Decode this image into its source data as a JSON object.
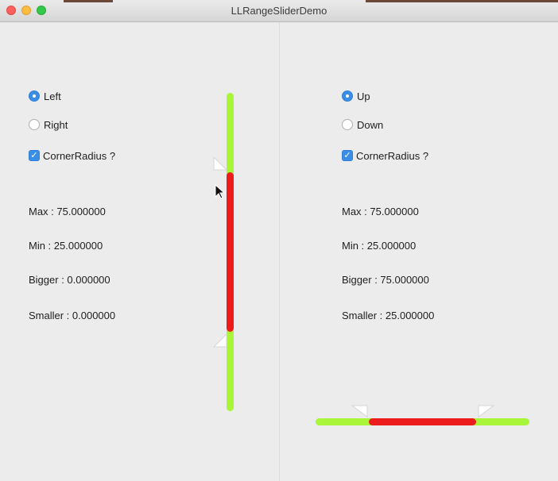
{
  "window": {
    "title": "LLRangeSliderDemo"
  },
  "left_panel": {
    "orientation_options": [
      {
        "label": "Left",
        "selected": true
      },
      {
        "label": "Right",
        "selected": false
      }
    ],
    "corner_radius": {
      "label": "CornerRadius ?",
      "checked": true
    },
    "readouts": {
      "max": "Max : 75.000000",
      "min": "Min : 25.000000",
      "bigger": "Bigger : 0.000000",
      "smaller": "Smaller : 0.000000"
    },
    "slider": {
      "min": 0,
      "max": 100,
      "lower": 25,
      "upper": 75
    }
  },
  "right_panel": {
    "orientation_options": [
      {
        "label": "Up",
        "selected": true
      },
      {
        "label": "Down",
        "selected": false
      }
    ],
    "corner_radius": {
      "label": "CornerRadius ?",
      "checked": true
    },
    "readouts": {
      "max": "Max : 75.000000",
      "min": "Min : 25.000000",
      "bigger": "Bigger : 75.000000",
      "smaller": "Smaller : 25.000000"
    },
    "slider": {
      "min": 0,
      "max": 100,
      "lower": 25,
      "upper": 75
    }
  },
  "colors": {
    "track": "#a8f53a",
    "range": "#ec1c1c",
    "accent": "#3a8ee6"
  },
  "icons": {
    "checkbox": "checkmark-icon",
    "cursor": "arrow-cursor-icon"
  }
}
